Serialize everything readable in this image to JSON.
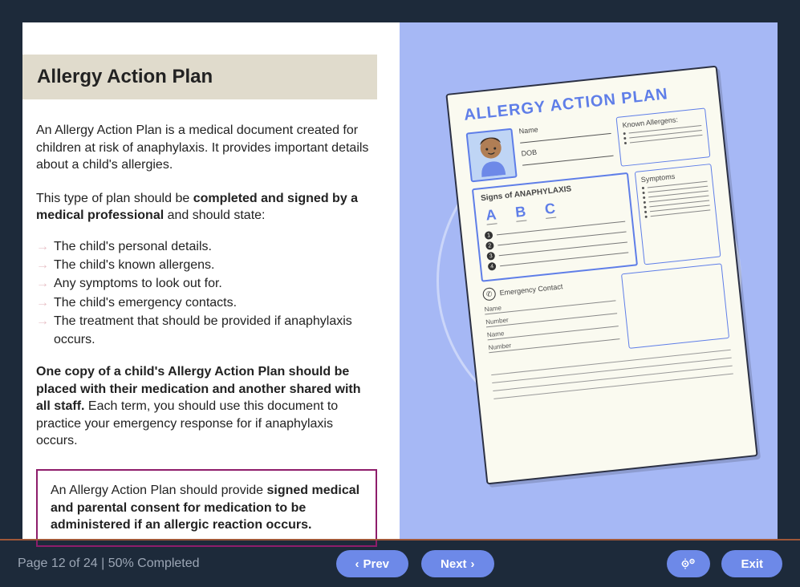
{
  "header": {
    "title": "Allergy Action Plan"
  },
  "content": {
    "intro": "An Allergy Action Plan is a medical document created for children at risk of anaphylaxis. It provides important details about a child's allergies.",
    "prelist_a": "This type of plan should be ",
    "prelist_bold": "completed and signed by a medical professional",
    "prelist_b": " and should state:",
    "bullets": [
      "The child's personal details.",
      "The child's known allergens.",
      "Any symptoms to look out for.",
      "The child's emergency contacts.",
      "The treatment that should be provided if anaphylaxis occurs."
    ],
    "para2_bold": "One copy of a child's Allergy Action Plan should be placed with their medication and another shared with all staff.",
    "para2_rest": " Each term, you should use this document to practice your emergency response for if anaphylaxis occurs.",
    "callout_a": "An Allergy Action Plan should provide ",
    "callout_bold": "signed medical and parental consent for medication to be administered if an allergic reaction occurs."
  },
  "illustration": {
    "doc_title": "ALLERGY ACTION PLAN",
    "name_label": "Name",
    "dob_label": "DOB",
    "allergens_label": "Known Allergens:",
    "signs_label": "Signs of ANAPHYLAXIS",
    "abc": [
      "A",
      "B",
      "C"
    ],
    "symptoms_label": "Symptoms",
    "emergency_label": "Emergency Contact",
    "name2": "Name",
    "number": "Number",
    "name3": "Name",
    "number2": "Number"
  },
  "footer": {
    "progress": "Page 12 of 24 | 50% Completed",
    "prev": "Prev",
    "next": "Next",
    "exit": "Exit"
  }
}
